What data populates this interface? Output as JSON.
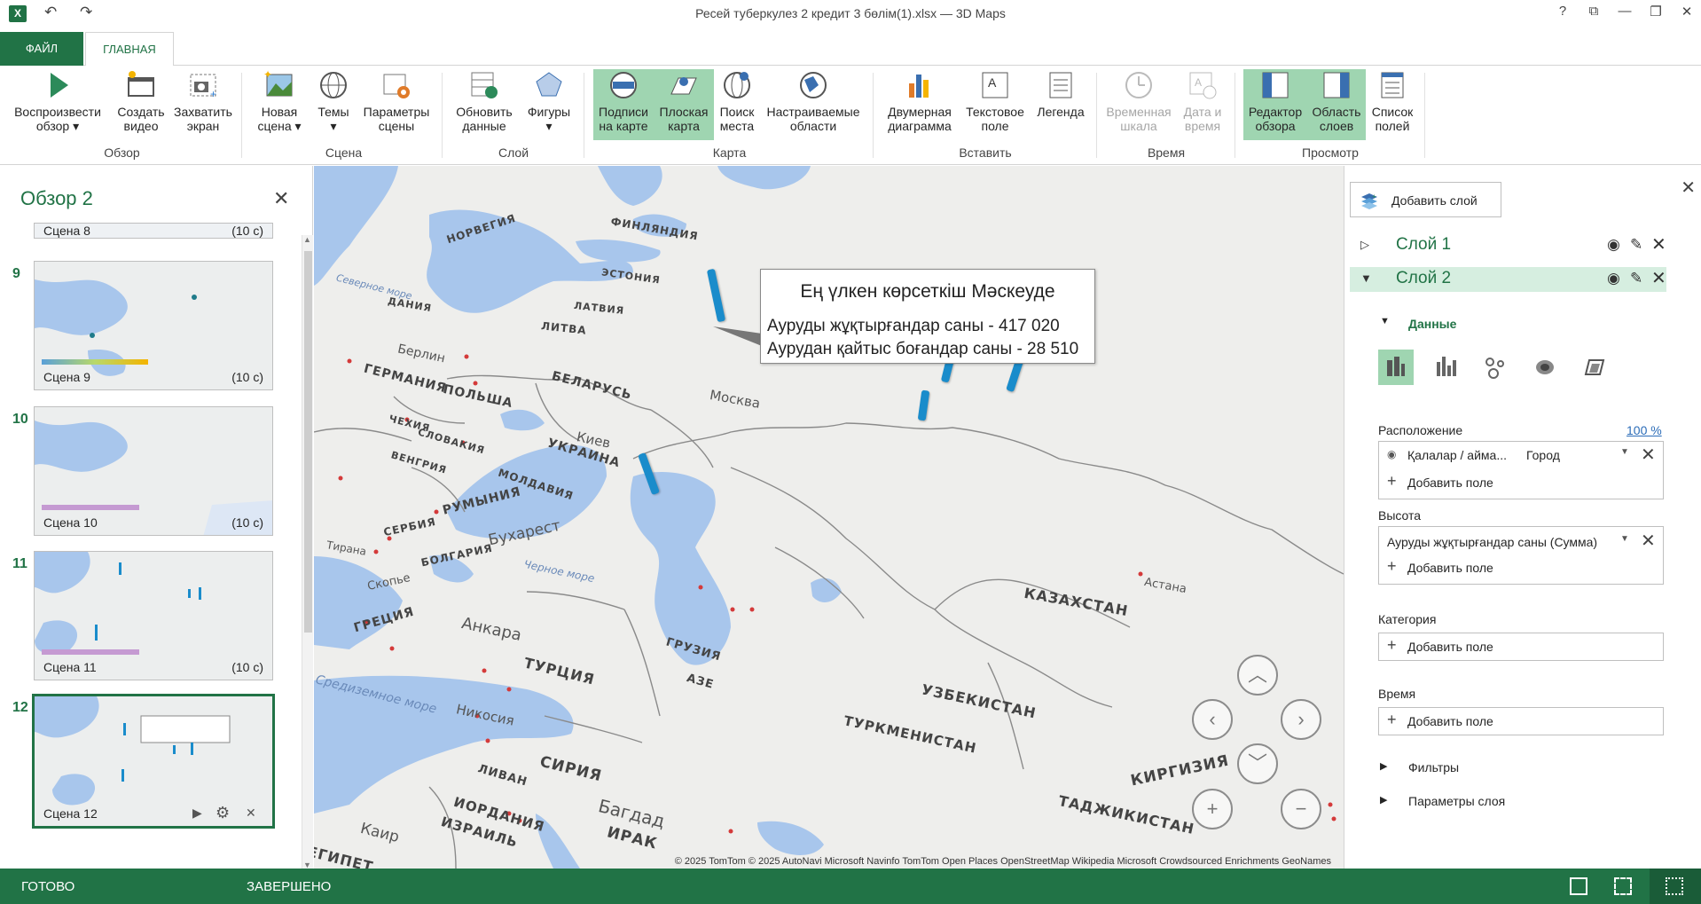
{
  "app": {
    "icon_text": "X",
    "title": "Ресей туберкулез 2 кредит 3 бөлім(1).xlsx — 3D Maps",
    "help": "?",
    "window_buttons": [
      "?",
      "⧉",
      "—",
      "❐",
      "✕"
    ]
  },
  "tabs": {
    "file": "ФАЙЛ",
    "home": "ГЛАВНАЯ"
  },
  "ribbon": {
    "buttons": [
      {
        "label1": "Воспроизвести",
        "label2": "обзор ▾"
      },
      {
        "label1": "Создать",
        "label2": "видео"
      },
      {
        "label1": "Захватить",
        "label2": "экран"
      },
      {
        "label1": "Новая",
        "label2": "сцена ▾"
      },
      {
        "label1": "Темы",
        "label2": "▾"
      },
      {
        "label1": "Параметры",
        "label2": "сцены"
      },
      {
        "label1": "Обновить",
        "label2": "данные"
      },
      {
        "label1": "Фигуры",
        "label2": "▾"
      },
      {
        "label1": "Подписи",
        "label2": "на карте"
      },
      {
        "label1": "Плоская",
        "label2": "карта"
      },
      {
        "label1": "Поиск",
        "label2": "места"
      },
      {
        "label1": "Настраиваемые",
        "label2": "области"
      },
      {
        "label1": "Двумерная",
        "label2": "диаграмма"
      },
      {
        "label1": "Текстовое",
        "label2": "поле"
      },
      {
        "label1": "Легенда",
        "label2": ""
      },
      {
        "label1": "Временная",
        "label2": "шкала"
      },
      {
        "label1": "Дата и",
        "label2": "время"
      },
      {
        "label1": "Редактор",
        "label2": "обзора"
      },
      {
        "label1": "Область",
        "label2": "слоев"
      },
      {
        "label1": "Список",
        "label2": "полей"
      }
    ],
    "groups": [
      "Обзор",
      "Сцена",
      "Слой",
      "Карта",
      "Вставить",
      "Время",
      "Просмотр"
    ]
  },
  "tour": {
    "title": "Обзор 2",
    "close": "✕",
    "scenes": [
      {
        "num": "",
        "label": "Сцена 8",
        "duration": "(10 с)"
      },
      {
        "num": "9",
        "label": "Сцена 9",
        "duration": "(10 с)"
      },
      {
        "num": "10",
        "label": "Сцена 10",
        "duration": "(10 с)"
      },
      {
        "num": "11",
        "label": "Сцена 11",
        "duration": "(10 с)"
      },
      {
        "num": "12",
        "label": "Сцена 12",
        "duration": ""
      }
    ]
  },
  "map": {
    "callout": {
      "title": "Ең үлкен көрсеткіш Мәскеуде",
      "line1": "Ауруды жұқтырғандар саны - 417 020",
      "line2": "Аурудан қайтыс боғандар саны - 28 510"
    },
    "countries": [
      "НОРВЕГИЯ",
      "ФИНЛЯНДИЯ",
      "ЭСТОНИЯ",
      "ЛАТВИЯ",
      "ЛИТВА",
      "ДАНИЯ",
      "ГЕРМАНИЯ",
      "ПОЛЬША",
      "БЕЛАРУСЬ",
      "ЧЕХИЯ",
      "СЛОВАКИЯ",
      "УКРАИНА",
      "ВЕНГРИЯ",
      "МОЛДАВИЯ",
      "РУМЫНИЯ",
      "СЕРБИЯ",
      "БОЛГАРИЯ",
      "ГРЕЦИЯ",
      "ТУРЦИЯ",
      "ГРУЗИЯ",
      "АЗЕ",
      "СИРИЯ",
      "ЛИВАН",
      "ИОРДАНИЯ",
      "ИЗРАИЛЬ",
      "ИРАК",
      "ЕГИПЕТ",
      "КАЗАХСТАН",
      "УЗБЕКИСТАН",
      "ТУРКМЕНИСТАН",
      "КИРГИЗИЯ",
      "ТАДЖИКИСТАН"
    ],
    "cities": [
      "Москва",
      "Берлин",
      "Киев",
      "Бухарест",
      "Анкара",
      "Никосия",
      "Багдад",
      "Каир",
      "Астана",
      "Тирана",
      "Скопье"
    ],
    "seas": [
      "Северное море",
      "Черное море",
      "Средиземное море"
    ],
    "attribution": "© 2025 TomTom  © 2025 AutoNavi  Microsoft  Navinfo  TomTom  Open Places  OpenStreetMap  Wikipedia  Microsoft Crowdsourced Enrichments  GeoNames"
  },
  "layers_pane": {
    "add_layer": "Добавить слой",
    "layers": [
      {
        "name": "Слой 1"
      },
      {
        "name": "Слой 2"
      }
    ],
    "data_header": "Данные",
    "location_label": "Расположение",
    "location_pct": "100 %",
    "location_field": "Қалалар / айма...",
    "location_type": "Город",
    "add_field": "Добавить поле",
    "height_label": "Высота",
    "height_field": "Ауруды жұқтырғандар саны (Сумма)",
    "category_label": "Категория",
    "time_label": "Время",
    "filters_label": "Фильтры",
    "layer_options_label": "Параметры слоя"
  },
  "status": {
    "left": "ГОТОВО",
    "middle": "ЗАВЕРШЕНО"
  }
}
